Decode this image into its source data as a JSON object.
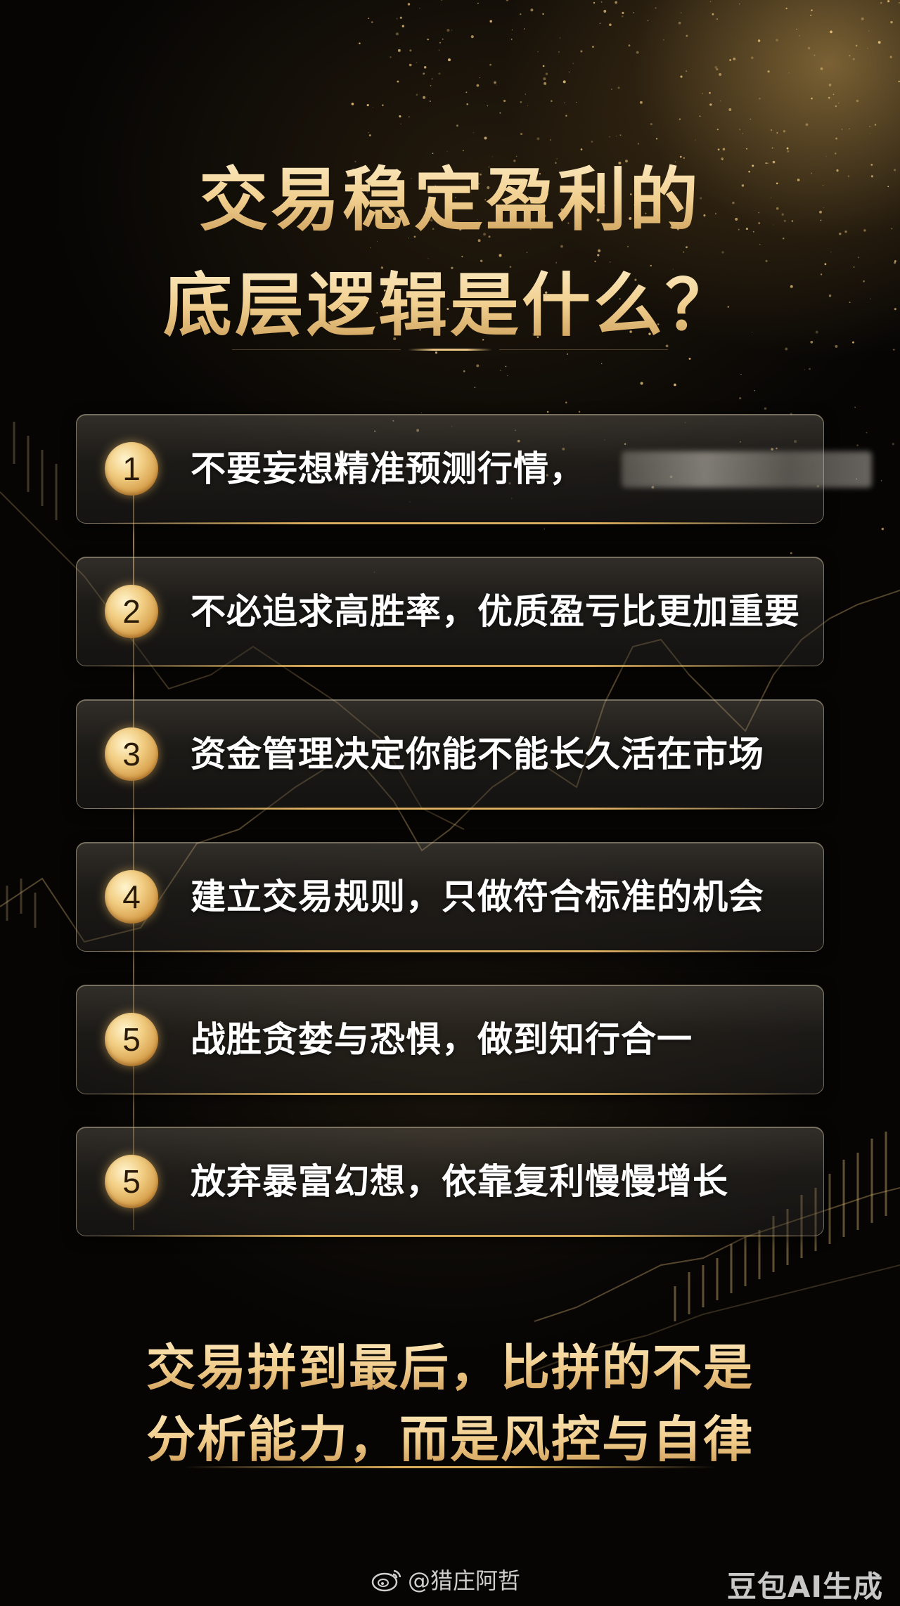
{
  "title": {
    "line1": "交易稳定盈利的",
    "line2": "底层逻辑是什么？"
  },
  "items": [
    {
      "number": "1",
      "text": "不要妄想精准预测行情，",
      "redacted": true
    },
    {
      "number": "2",
      "text": "不必追求高胜率，优质盈亏比更加重要"
    },
    {
      "number": "3",
      "text": "资金管理决定你能不能长久活在市场"
    },
    {
      "number": "4",
      "text": "建立交易规则，只做符合标准的机会"
    },
    {
      "number": "5",
      "text": "战胜贪婪与恐惧，做到知行合一"
    },
    {
      "number": "5",
      "text": "放弃暴富幻想，依靠复利慢慢增长"
    }
  ],
  "footer": {
    "line1": "交易拼到最后，比拼的不是",
    "line2": "分析能力，而是风控与自律"
  },
  "credit": {
    "icon": "weibo-icon",
    "handle": "@猎庄阿哲"
  },
  "watermark": "豆包AI生成",
  "colors": {
    "background": "#060504",
    "gold": "#efc987",
    "text": "#ffffff"
  }
}
